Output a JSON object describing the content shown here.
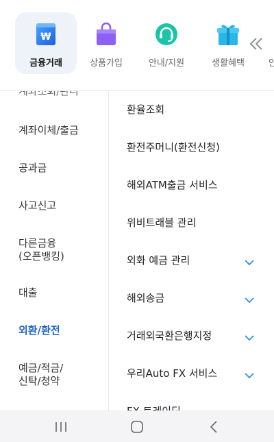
{
  "top_tabs": [
    {
      "label": "금융거래",
      "icon": "won-wallet-icon",
      "active": true
    },
    {
      "label": "상품가입",
      "icon": "shopping-bag-icon",
      "active": false
    },
    {
      "label": "안내/지원",
      "icon": "headset-icon",
      "active": false
    },
    {
      "label": "생활혜택",
      "icon": "gift-box-icon",
      "active": false
    }
  ],
  "top_overflow_label": "안",
  "left_menu": {
    "cut_item": "계좌조회/관리",
    "items": [
      {
        "label": "계좌이체/출금"
      },
      {
        "label": "공과금"
      },
      {
        "label": "사고신고"
      },
      {
        "label": "다른금융\n(오픈뱅킹)"
      },
      {
        "label": "대출"
      },
      {
        "label": "외환/환전",
        "active": true
      },
      {
        "label": "예금/적금/\n신탁/청약"
      }
    ]
  },
  "sub_menu": {
    "items": [
      {
        "label": "환율조회",
        "expandable": false
      },
      {
        "label": "환전주머니(환전신청)",
        "expandable": false
      },
      {
        "label": "해외ATM출금 서비스",
        "expandable": false
      },
      {
        "label": "위비트래블 관리",
        "expandable": false
      },
      {
        "label": "외화 예금 관리",
        "expandable": true
      },
      {
        "label": "해외송금",
        "expandable": true
      },
      {
        "label": "거래외국환은행지정",
        "expandable": true
      },
      {
        "label": "우리Auto FX 서비스",
        "expandable": true
      },
      {
        "label": "FX 트레이딩",
        "expandable": false
      }
    ]
  },
  "colors": {
    "accent": "#1f63c9",
    "active_tab_bg": "#eef2f9",
    "chevron": "#2f8fe0",
    "divider": "#e6e8ec"
  }
}
